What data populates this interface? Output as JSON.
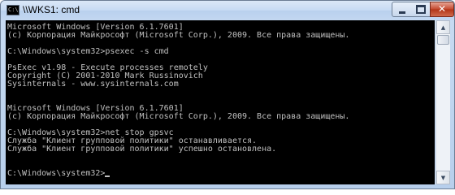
{
  "window": {
    "title": "\\\\WKS1: cmd",
    "icon": "cmd-console-icon",
    "icon_text": "C:\\"
  },
  "controls": {
    "minimize_icon": "minimize-icon",
    "maximize_icon": "maximize-icon",
    "close_glyph": "✕"
  },
  "console": {
    "background": "#000000",
    "foreground": "#c0c0c0",
    "lines": [
      "Microsoft Windows [Version 6.1.7601]",
      "(c) Корпорация Майкрософт (Microsoft Corp.), 2009. Все права защищены.",
      "",
      "C:\\Windows\\system32>psexec -s cmd",
      "",
      "PsExec v1.98 - Execute processes remotely",
      "Copyright (C) 2001-2010 Mark Russinovich",
      "Sysinternals - www.sysinternals.com",
      "",
      "",
      "Microsoft Windows [Version 6.1.7601]",
      "(c) Корпорация Майкрософт (Microsoft Corp.), 2009. Все права защищены.",
      "",
      "C:\\Windows\\system32>net stop gpsvc",
      "Служба \"Клиент групповой политики\" останавливается.",
      "Служба \"Клиент групповой политики\" успешно остановлена.",
      "",
      "",
      "C:\\Windows\\system32>"
    ]
  },
  "scrollbar": {
    "up_glyph": "▲",
    "down_glyph": "▼"
  }
}
